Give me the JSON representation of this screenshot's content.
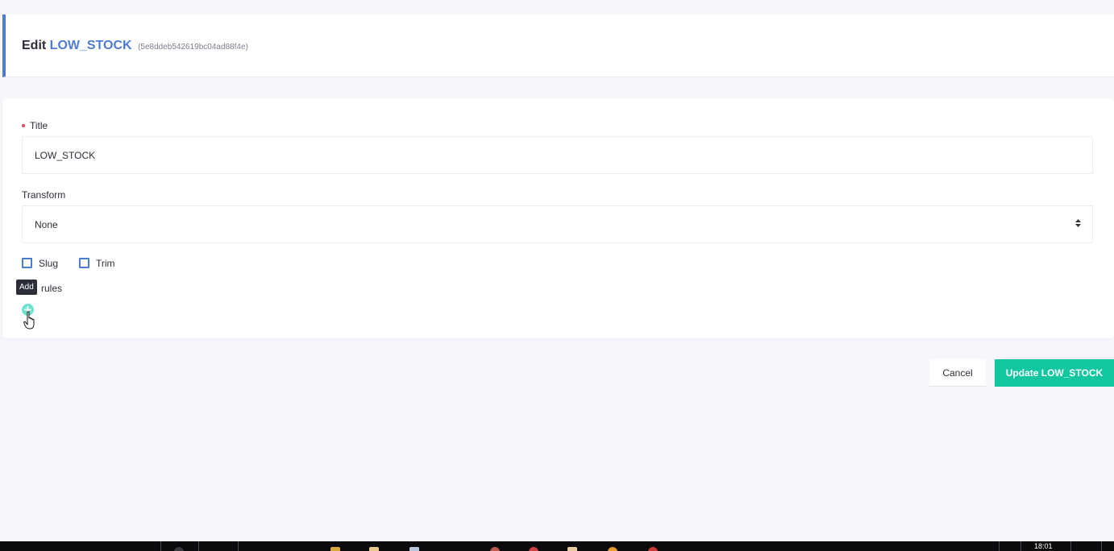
{
  "header": {
    "prefix": "Edit",
    "entity_name": "LOW_STOCK",
    "entity_id": "(5e8ddeb542619bc04ad88f4e)"
  },
  "form": {
    "title_label": "Title",
    "title_value": "LOW_STOCK",
    "transform_label": "Transform",
    "transform_value": "None",
    "checkboxes": [
      {
        "label": "Slug",
        "checked": false
      },
      {
        "label": "Trim",
        "checked": false
      }
    ],
    "rules_label": "rules",
    "add_tooltip": "Add"
  },
  "actions": {
    "cancel_label": "Cancel",
    "update_label": "Update LOW_STOCK"
  },
  "taskbar": {
    "clock": "18:01"
  },
  "colors": {
    "accent": "#4d7cd6",
    "primary_button": "#11c6a0",
    "add_icon": "#6fe3cf",
    "required": "#e0475b",
    "background": "#f8f5fb"
  }
}
